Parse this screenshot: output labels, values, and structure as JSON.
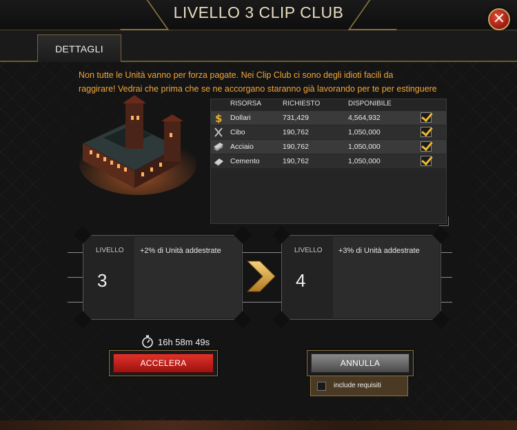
{
  "header": {
    "title": "LIVELLO 3 CLIP CLUB",
    "close_symbol": "✕"
  },
  "tabs": [
    {
      "label": "DETTAGLI",
      "active": true
    }
  ],
  "description": {
    "line1": "Non tutte le Unità vanno per forza pagate. Nei Clip Club ci sono degli idioti facili da",
    "line2": "raggirare! Vedrai che prima che se ne accorgano staranno già lavorando per te per estinguere"
  },
  "resources": {
    "headers": {
      "resource": "RISORSA",
      "required": "RICHIESTO",
      "available": "DISPONIBILE"
    },
    "rows": [
      {
        "icon": "dollar-icon",
        "name": "Dollari",
        "required": "731,429",
        "available": "4,564,932",
        "satisfied": true
      },
      {
        "icon": "food-icon",
        "name": "Cibo",
        "required": "190,762",
        "available": "1,050,000",
        "satisfied": true
      },
      {
        "icon": "steel-icon",
        "name": "Acciaio",
        "required": "190,762",
        "available": "1,050,000",
        "satisfied": true
      },
      {
        "icon": "cement-icon",
        "name": "Cemento",
        "required": "190,762",
        "available": "1,050,000",
        "satisfied": true
      }
    ]
  },
  "current_level": {
    "label": "LIVELLO",
    "number": "3",
    "bonus": "+2% di Unità addestrate"
  },
  "next_level": {
    "label": "LIVELLO",
    "number": "4",
    "bonus": "+3% di Unità addestrate"
  },
  "timer": {
    "icon": "stopwatch-icon",
    "text": "16h 58m 49s"
  },
  "buttons": {
    "accelerate": "ACCELERA",
    "cancel": "ANNULLA"
  },
  "include_requirements": {
    "label": "include requisiti",
    "checked": false
  },
  "colors": {
    "accent": "#f0a53a",
    "gold_frame": "#8a7340",
    "danger": "#c81e16"
  }
}
